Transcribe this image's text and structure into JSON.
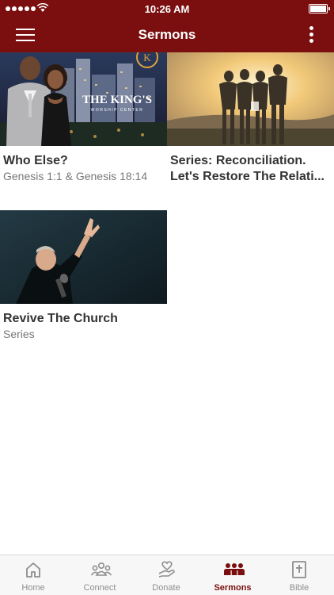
{
  "status_bar": {
    "time": "10:26 AM"
  },
  "nav": {
    "title": "Sermons"
  },
  "sermons": [
    {
      "title": "Who Else?",
      "subtitle": "Genesis 1:1 & Genesis 18:14",
      "thumb_text": "THE KING'S",
      "thumb_sub": "WORSHIP CENTER",
      "logo_letter": "K"
    },
    {
      "title": "Series: Reconciliation. Let's Restore The Relati...",
      "subtitle": ""
    },
    {
      "title": "Revive The Church",
      "subtitle": "Series"
    }
  ],
  "tabs": [
    {
      "label": "Home",
      "icon": "home-icon",
      "active": false
    },
    {
      "label": "Connect",
      "icon": "people-icon",
      "active": false
    },
    {
      "label": "Donate",
      "icon": "heart-hand-icon",
      "active": false
    },
    {
      "label": "Sermons",
      "icon": "group-icon",
      "active": true
    },
    {
      "label": "Bible",
      "icon": "bible-icon",
      "active": false
    }
  ],
  "colors": {
    "brand": "#7b0f0f",
    "tab_inactive": "#8e8e8e"
  }
}
